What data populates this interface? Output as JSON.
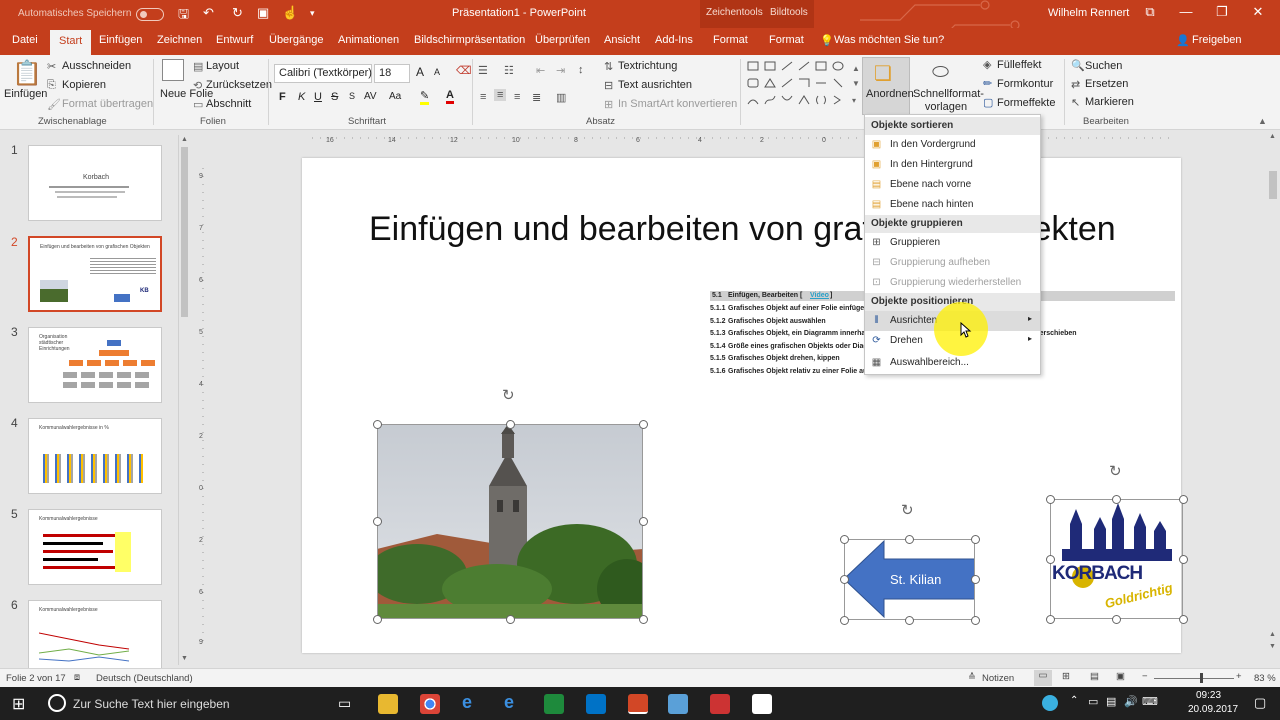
{
  "app": {
    "title": "Präsentation1 - PowerPoint",
    "autosave_label": "Automatisches Speichern",
    "autosave_state": "Aus",
    "user": "Wilhelm Rennert",
    "share": "Freigeben",
    "context_tools": [
      "Zeichentools",
      "Bildtools"
    ]
  },
  "tabs": [
    "Datei",
    "Start",
    "Einfügen",
    "Zeichnen",
    "Entwurf",
    "Übergänge",
    "Animationen",
    "Bildschirmpräsentation",
    "Überprüfen",
    "Ansicht",
    "Add-Ins",
    "Format",
    "Format"
  ],
  "tell_me": "Was möchten Sie tun?",
  "ribbon": {
    "clipboard": {
      "paste": "Einfügen",
      "cut": "Ausschneiden",
      "copy": "Kopieren",
      "format_painter": "Format übertragen",
      "label": "Zwischenablage"
    },
    "slides": {
      "new_slide": "Neue Folie",
      "layout": "Layout",
      "reset": "Zurücksetzen",
      "section": "Abschnitt",
      "label": "Folien"
    },
    "font": {
      "name": "Calibri (Textkörper)",
      "size": "18",
      "label": "Schriftart",
      "bold": "F",
      "italic": "K",
      "underline": "U",
      "strike": "S",
      "spacing": "AV",
      "case": "Aa",
      "grow": "A",
      "shrink": "A"
    },
    "paragraph": {
      "direction": "Textrichtung",
      "align_text": "Text ausrichten",
      "smartart": "In SmartArt konvertieren",
      "label": "Absatz"
    },
    "drawing": {
      "arrange": "Anordnen",
      "quick_styles": "Schnellformat-vorlagen",
      "fill": "Fülleffekt",
      "outline": "Formkontur",
      "effects": "Formeffekte",
      "label": "Zeichnung"
    },
    "editing": {
      "find": "Suchen",
      "replace": "Ersetzen",
      "select": "Markieren",
      "label": "Bearbeiten"
    }
  },
  "thumbnails": [
    {
      "num": "1",
      "title": "Korbach"
    },
    {
      "num": "2",
      "title": "Einfügen und bearbeiten von grafischen Objekten"
    },
    {
      "num": "3",
      "title": "Organisation städtischer Einrichtungen"
    },
    {
      "num": "4",
      "title": "Kommunalwahlergebnisse in %"
    },
    {
      "num": "5",
      "title": "Kommunalwahlergebnisse"
    },
    {
      "num": "6",
      "title": "Kommunalwahlergebnisse"
    }
  ],
  "slide": {
    "title": "Einfügen und bearbeiten von grafischen Objekten",
    "bullets": [
      {
        "num": "5.1",
        "text": "Einfügen, Bearbeiten [",
        "link": "Video",
        "close": "]"
      },
      {
        "num": "5.1.1",
        "text": "Grafisches Objekt auf einer Folie einfügen"
      },
      {
        "num": "5.1.2",
        "text": "Grafisches Objekt auswählen"
      },
      {
        "num": "5.1.3",
        "text": "Grafisches Objekt, ein Diagramm innerhalb einer Präsentation oder in eine andere kopieren, verschieben"
      },
      {
        "num": "5.1.4",
        "text": "Größe eines grafischen Objekts oder Diagramms ändern, ein Objekt löschen"
      },
      {
        "num": "5.1.5",
        "text": "Grafisches Objekt drehen, kippen"
      },
      {
        "num": "5.1.6",
        "text": "Grafisches Objekt relativ zu einer Folie ausrichten: links, zentriert, rechts, oben, unten"
      }
    ],
    "arrow_label": "St. Kilian",
    "logo_main": "KORBACH",
    "logo_sub": "Goldrichtig"
  },
  "menu": {
    "h_sort": "Objekte sortieren",
    "front": "In den Vordergrund",
    "back": "In den Hintergrund",
    "forward": "Ebene nach vorne",
    "backward": "Ebene nach hinten",
    "h_group": "Objekte gruppieren",
    "group": "Gruppieren",
    "ungroup": "Gruppierung aufheben",
    "regroup": "Gruppierung wiederherstellen",
    "h_position": "Objekte positionieren",
    "align": "Ausrichten",
    "rotate": "Drehen",
    "selection_pane": "Auswahlbereich..."
  },
  "status": {
    "slide": "Folie 2 von 17",
    "language": "Deutsch (Deutschland)",
    "notes": "Notizen",
    "zoom": "83 %"
  },
  "taskbar": {
    "search": "Zur Suche Text hier eingeben",
    "time": "09:23",
    "date": "20.09.2017"
  },
  "colors": {
    "accent": "#c43e1c",
    "arrow": "#4472c4",
    "logo_blue": "#1f2a78",
    "logo_gold": "#d8b400"
  }
}
